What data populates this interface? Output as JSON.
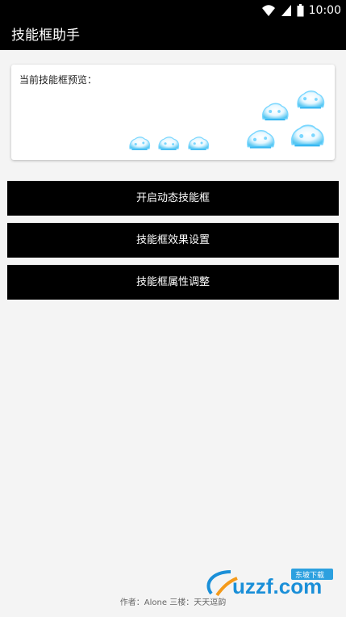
{
  "status_bar": {
    "time": "10:00",
    "icons": [
      "wifi-icon",
      "signal-icon",
      "battery-icon"
    ]
  },
  "app_bar": {
    "title": "技能框助手"
  },
  "preview": {
    "label": "当前技能框预览："
  },
  "buttons": {
    "start_dynamic": "开启动态技能框",
    "effect_settings": "技能框效果设置",
    "attribute_adjust": "技能框属性调整"
  },
  "footer": {
    "author": "作者：Alone 三楼：天天逗韵"
  },
  "watermark": {
    "text": "uzzf.com",
    "badge": "东坡下载"
  },
  "colors": {
    "bar_background": "#000000",
    "page_background": "#f4f4f4",
    "button_background": "#000000",
    "frame_glow": "#57c7f2",
    "watermark_orange": "#f49a1a",
    "watermark_blue": "#1a8fd8"
  }
}
